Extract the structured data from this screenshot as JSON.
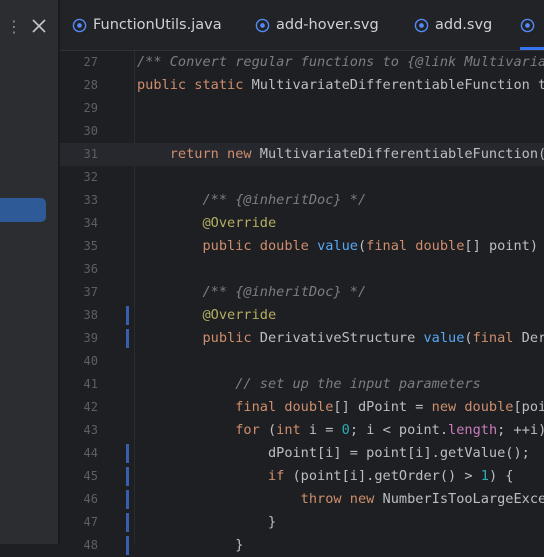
{
  "left_panel": {
    "menu_glyph": "⋮"
  },
  "tabs": [
    {
      "label": "FunctionUtils.java",
      "icon": "class-icon",
      "active": false
    },
    {
      "label": "add-hover.svg",
      "icon": "image-file-icon",
      "active": false
    },
    {
      "label": "add.svg",
      "icon": "image-file-icon",
      "active": false
    },
    {
      "label": "",
      "icon": "image-file-icon",
      "active": true
    }
  ],
  "colors": {
    "accent": "#3574f0",
    "keyword": "#cf8e6d",
    "annotation": "#b3ae60",
    "function": "#56a8f5",
    "comment": "#7a7e85",
    "number": "#2aacb8",
    "field": "#c77dbb"
  },
  "editor": {
    "current_line": "31",
    "lines": [
      {
        "num": "27",
        "segs": [
          {
            "t": "/** Convert regular functions to {@link Multivaria",
            "c": "comment"
          }
        ]
      },
      {
        "num": "28",
        "segs": [
          {
            "t": "public static ",
            "c": "kw"
          },
          {
            "t": "MultivariateDifferentiableFunction t",
            "c": "txt"
          }
        ]
      },
      {
        "num": "29",
        "segs": []
      },
      {
        "num": "30",
        "segs": []
      },
      {
        "num": "31",
        "segs": [
          {
            "t": "    return new ",
            "c": "kw"
          },
          {
            "t": "MultivariateDifferentiableFunction(",
            "c": "txt"
          }
        ]
      },
      {
        "num": "32",
        "segs": []
      },
      {
        "num": "33",
        "segs": [
          {
            "t": "        /** ",
            "c": "comment"
          },
          {
            "t": "{@inheritDoc}",
            "c": "doctag"
          },
          {
            "t": " */",
            "c": "comment"
          }
        ]
      },
      {
        "num": "34",
        "segs": [
          {
            "t": "        @Override",
            "c": "ann"
          }
        ]
      },
      {
        "num": "35",
        "segs": [
          {
            "t": "        public double ",
            "c": "kw"
          },
          {
            "t": "value",
            "c": "fn"
          },
          {
            "t": "(",
            "c": "txt"
          },
          {
            "t": "final double",
            "c": "kw"
          },
          {
            "t": "[] point)",
            "c": "txt"
          }
        ]
      },
      {
        "num": "36",
        "segs": []
      },
      {
        "num": "37",
        "segs": [
          {
            "t": "        /** ",
            "c": "comment"
          },
          {
            "t": "{@inheritDoc}",
            "c": "doctag"
          },
          {
            "t": " */",
            "c": "comment"
          }
        ]
      },
      {
        "num": "38",
        "segs": [
          {
            "t": "        @Override",
            "c": "ann"
          }
        ],
        "marker": true
      },
      {
        "num": "39",
        "segs": [
          {
            "t": "        public ",
            "c": "kw"
          },
          {
            "t": "DerivativeStructure ",
            "c": "txt"
          },
          {
            "t": "value",
            "c": "fn"
          },
          {
            "t": "(",
            "c": "txt"
          },
          {
            "t": "final ",
            "c": "kw"
          },
          {
            "t": "Der",
            "c": "txt"
          }
        ],
        "marker": true
      },
      {
        "num": "40",
        "segs": []
      },
      {
        "num": "41",
        "segs": [
          {
            "t": "            // set up the input parameters",
            "c": "comment"
          }
        ]
      },
      {
        "num": "42",
        "segs": [
          {
            "t": "            final double",
            "c": "kw"
          },
          {
            "t": "[] dPoint = ",
            "c": "txt"
          },
          {
            "t": "new double",
            "c": "kw"
          },
          {
            "t": "[poi",
            "c": "txt"
          }
        ]
      },
      {
        "num": "43",
        "segs": [
          {
            "t": "            for ",
            "c": "kw"
          },
          {
            "t": "(",
            "c": "txt"
          },
          {
            "t": "int ",
            "c": "kw"
          },
          {
            "t": "i = ",
            "c": "txt"
          },
          {
            "t": "0",
            "c": "num"
          },
          {
            "t": "; i < point.",
            "c": "txt"
          },
          {
            "t": "length",
            "c": "field"
          },
          {
            "t": "; ++i)",
            "c": "txt"
          }
        ]
      },
      {
        "num": "44",
        "segs": [
          {
            "t": "                dPoint[i] = point[i].getValue();",
            "c": "txt"
          }
        ],
        "marker": true
      },
      {
        "num": "45",
        "segs": [
          {
            "t": "                if ",
            "c": "kw"
          },
          {
            "t": "(point[i].getOrder() > ",
            "c": "txt"
          },
          {
            "t": "1",
            "c": "num"
          },
          {
            "t": ") {",
            "c": "txt"
          }
        ],
        "marker": true
      },
      {
        "num": "46",
        "segs": [
          {
            "t": "                    throw new ",
            "c": "kw"
          },
          {
            "t": "NumberIsTooLargeExce",
            "c": "txt"
          }
        ],
        "marker": true
      },
      {
        "num": "47",
        "segs": [
          {
            "t": "                }",
            "c": "txt"
          }
        ],
        "marker": true
      },
      {
        "num": "48",
        "segs": [
          {
            "t": "            }",
            "c": "txt"
          }
        ],
        "marker": true
      }
    ]
  }
}
